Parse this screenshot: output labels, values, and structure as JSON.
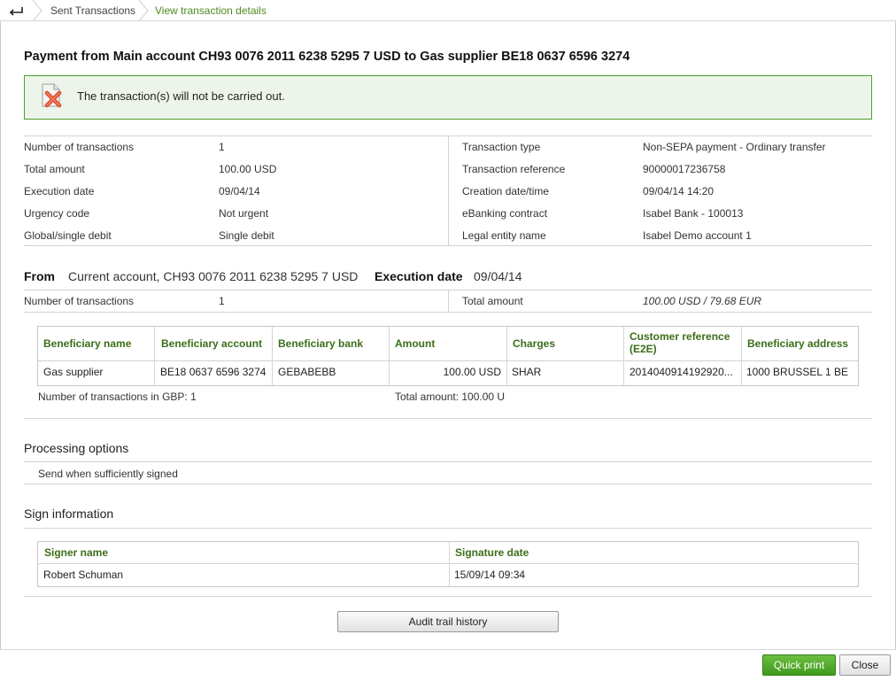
{
  "breadcrumb": {
    "items": [
      "Sent Transactions",
      "View transaction details"
    ]
  },
  "title": "Payment from Main account CH93 0076 2011 6238 5295 7 USD to Gas supplier BE18 0637 6596 3274",
  "alert": {
    "message": "The transaction(s) will not be carried out.",
    "icon": "error-document-icon"
  },
  "summary": {
    "left": [
      {
        "label": "Number of transactions",
        "value": "1"
      },
      {
        "label": "Total amount",
        "value": "100.00 USD"
      },
      {
        "label": "Execution date",
        "value": "09/04/14"
      },
      {
        "label": "Urgency code",
        "value": "Not urgent"
      },
      {
        "label": "Global/single debit",
        "value": "Single debit"
      }
    ],
    "right": [
      {
        "label": "Transaction type",
        "value": "Non-SEPA payment - Ordinary transfer"
      },
      {
        "label": "Transaction reference",
        "value": "90000017236758"
      },
      {
        "label": "Creation date/time",
        "value": "09/04/14 14:20"
      },
      {
        "label": "eBanking contract",
        "value": "Isabel Bank - 100013"
      },
      {
        "label": "Legal entity name",
        "value": "Isabel Demo account 1"
      }
    ]
  },
  "from": {
    "label": "From",
    "value": "Current account, CH93 0076 2011 6238 5295 7 USD",
    "exec_label": "Execution date",
    "exec_value": "09/04/14",
    "ntx_label": "Number of transactions",
    "ntx_value": "1",
    "total_label": "Total amount",
    "total_value": "100.00 USD / 79.68 EUR"
  },
  "beneficiary_table": {
    "headers": [
      "Beneficiary name",
      "Beneficiary account",
      "Beneficiary bank",
      "Amount",
      "Charges",
      "Customer reference (E2E)",
      "Beneficiary address"
    ],
    "rows": [
      [
        "Gas supplier",
        "BE18 0637 6596 3274",
        "GEBABEBB",
        "100.00 USD",
        "SHAR",
        "2014040914192920...",
        "1000 BRUSSEL 1 BE"
      ]
    ],
    "footer_count": "Number of transactions in GBP: 1",
    "footer_total": "Total amount: 100.00 U"
  },
  "processing": {
    "title": "Processing options",
    "value": "Send when sufficiently signed"
  },
  "sign": {
    "title": "Sign information",
    "headers": [
      "Signer name",
      "Signature date"
    ],
    "rows": [
      [
        "Robert Schuman",
        "15/09/14 09:34"
      ]
    ]
  },
  "buttons": {
    "audit": "Audit trail history",
    "quick_print": "Quick print",
    "close": "Close"
  },
  "colors": {
    "accent": "#3f9a1c",
    "header_text": "#3c6e17",
    "alert_bg": "#edf5ea"
  }
}
